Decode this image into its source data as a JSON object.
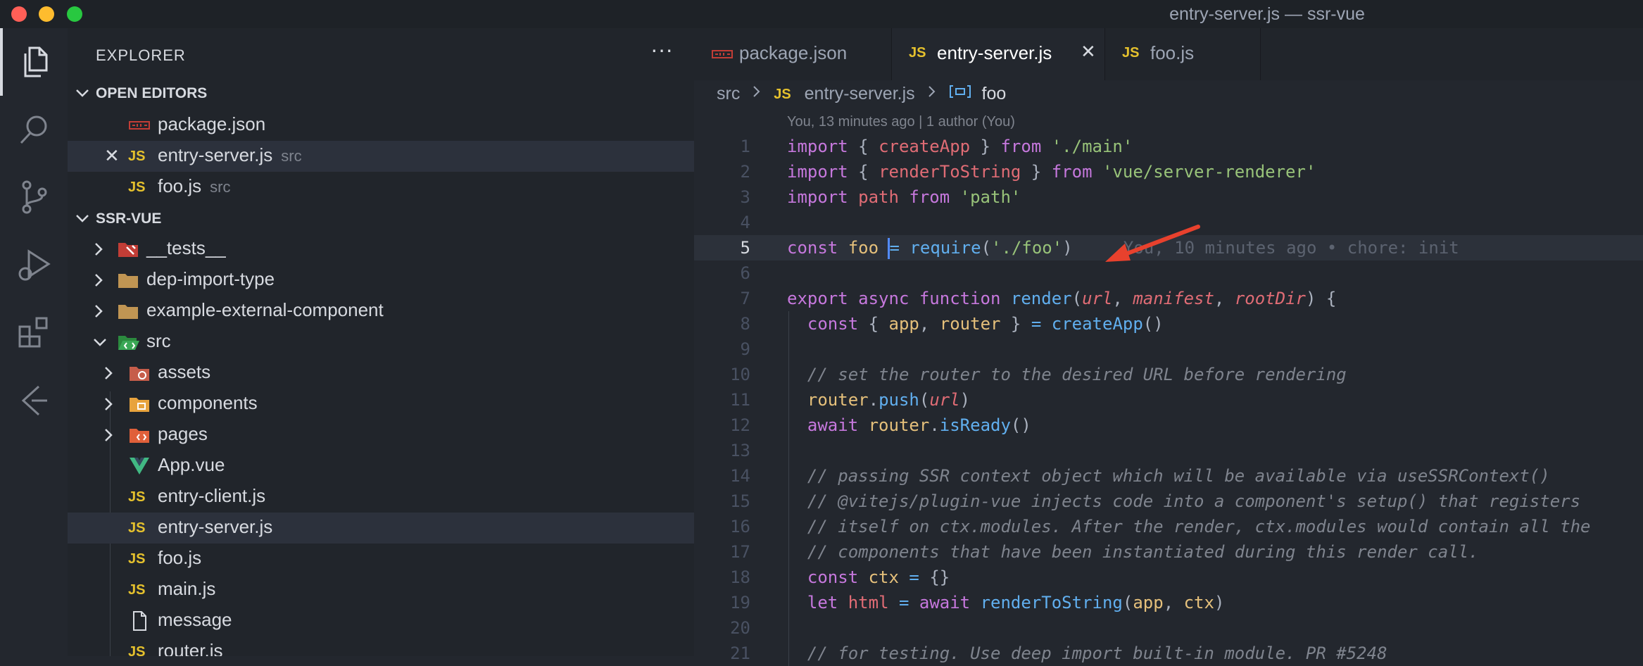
{
  "window": {
    "title": "entry-server.js — ssr-vue"
  },
  "sidebar": {
    "title": "EXPLORER",
    "more": "···",
    "open_editors": {
      "title": "OPEN EDITORS",
      "items": [
        {
          "name": "package.json",
          "hint": ""
        },
        {
          "name": "entry-server.js",
          "hint": "src"
        },
        {
          "name": "foo.js",
          "hint": "src"
        }
      ]
    },
    "project": {
      "title": "SSR-VUE",
      "items": [
        {
          "name": "__tests__"
        },
        {
          "name": "dep-import-type"
        },
        {
          "name": "example-external-component"
        },
        {
          "name": "src"
        },
        {
          "name": "assets"
        },
        {
          "name": "components"
        },
        {
          "name": "pages"
        },
        {
          "name": "App.vue"
        },
        {
          "name": "entry-client.js"
        },
        {
          "name": "entry-server.js"
        },
        {
          "name": "foo.js"
        },
        {
          "name": "main.js"
        },
        {
          "name": "message"
        },
        {
          "name": "router.js"
        }
      ]
    }
  },
  "tabs": [
    {
      "label": "package.json",
      "icon": "json-icon"
    },
    {
      "label": "entry-server.js",
      "icon": "js-icon"
    },
    {
      "label": "foo.js",
      "icon": "js-icon"
    }
  ],
  "breadcrumb": {
    "folder": "src",
    "file": "entry-server.js",
    "symbol": "foo"
  },
  "editor": {
    "codelens": "You, 13 minutes ago | 1 author (You)",
    "blame": "You, 10 minutes ago • chore: init",
    "line_numbers": [
      "1",
      "2",
      "3",
      "4",
      "5",
      "6",
      "7",
      "8",
      "9",
      "10",
      "11",
      "12",
      "13",
      "14",
      "15",
      "16",
      "17",
      "18",
      "19",
      "20",
      "21"
    ],
    "current_line": 5
  },
  "annotation": {
    "color": "#e8412d"
  }
}
